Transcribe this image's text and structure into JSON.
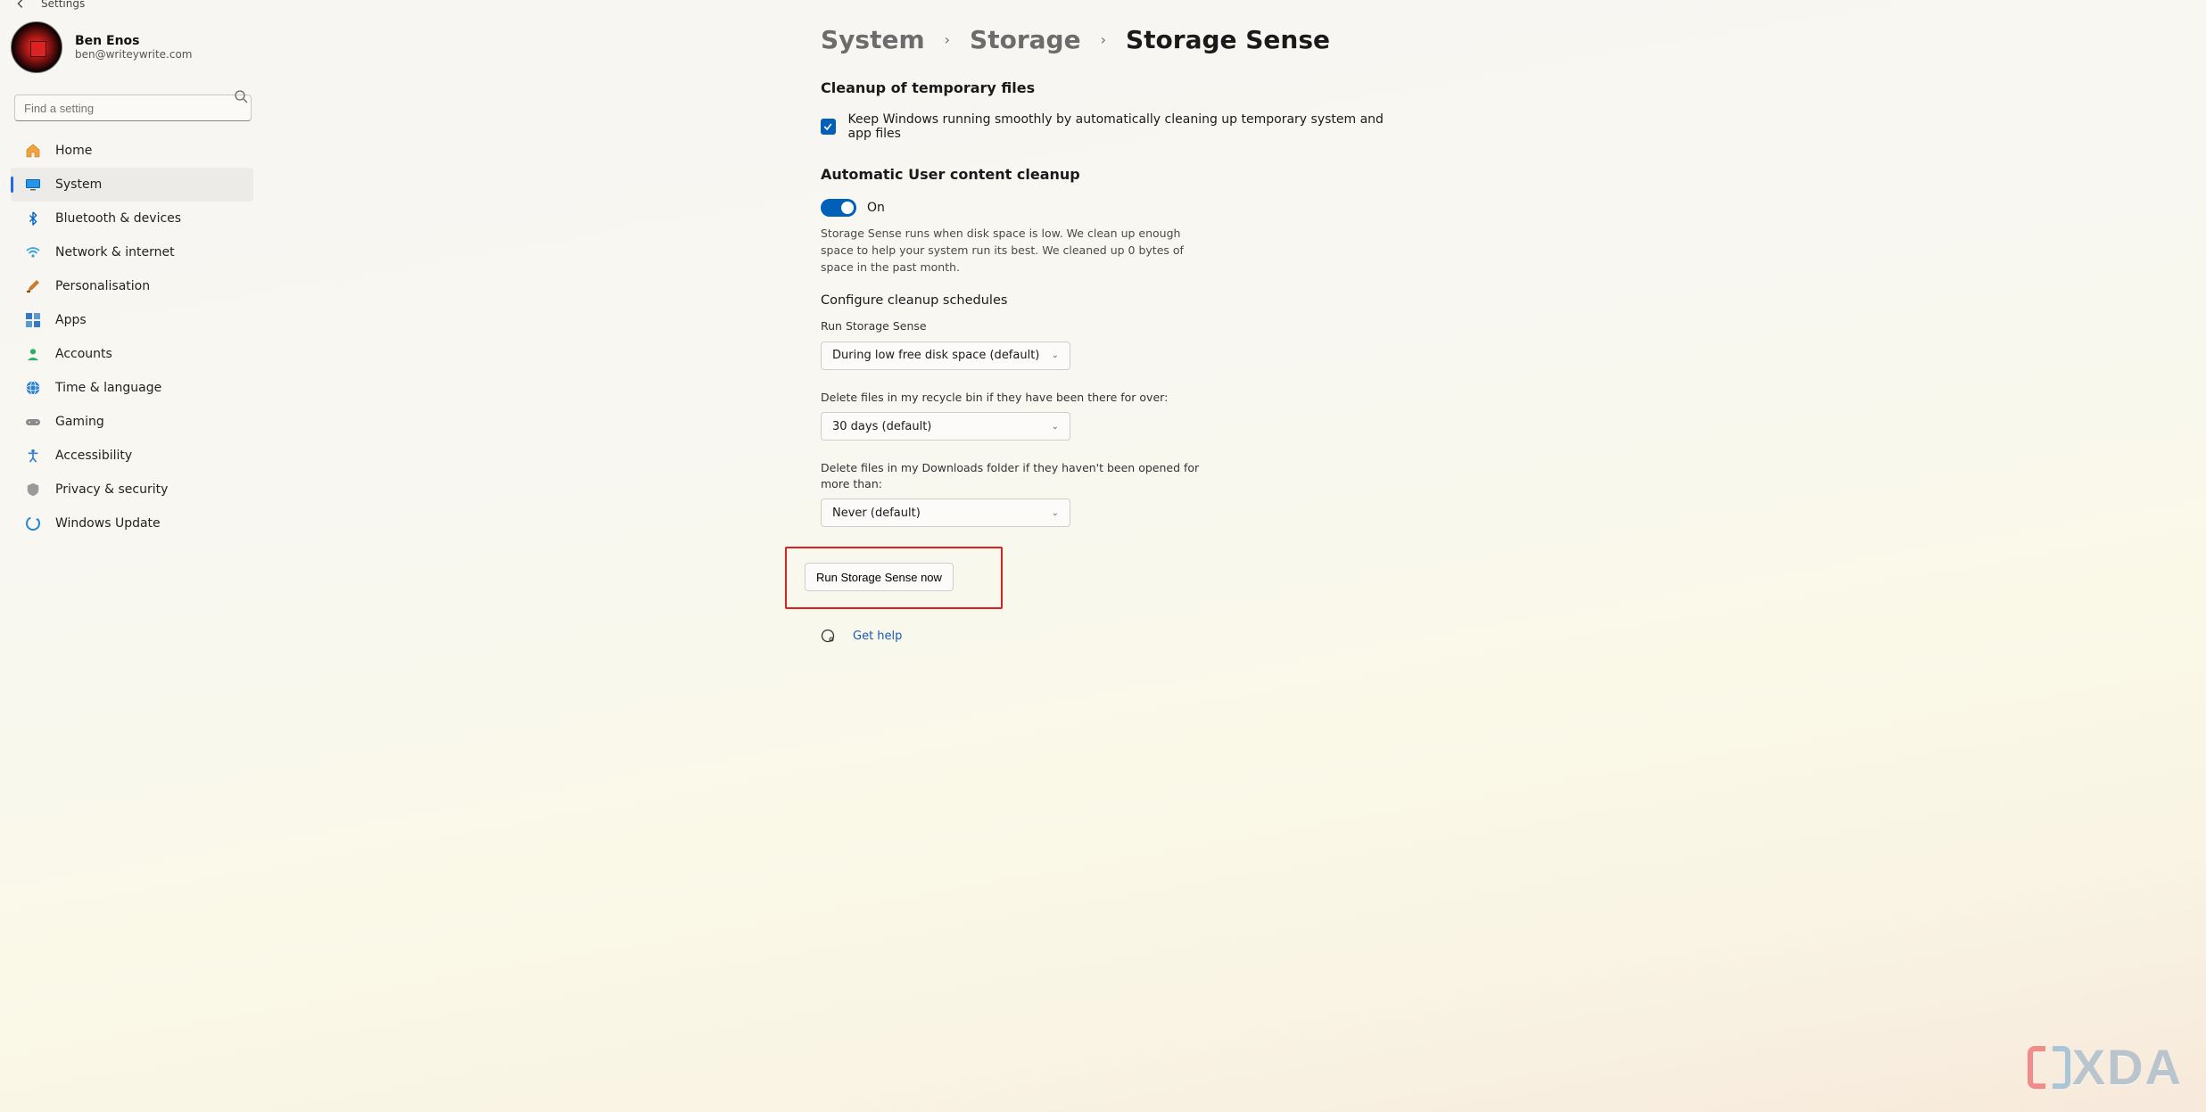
{
  "titlebar": {
    "label": "Settings"
  },
  "user": {
    "name": "Ben Enos",
    "email": "ben@writeywrite.com"
  },
  "search": {
    "placeholder": "Find a setting"
  },
  "nav": {
    "items": [
      {
        "label": "Home"
      },
      {
        "label": "System"
      },
      {
        "label": "Bluetooth & devices"
      },
      {
        "label": "Network & internet"
      },
      {
        "label": "Personalisation"
      },
      {
        "label": "Apps"
      },
      {
        "label": "Accounts"
      },
      {
        "label": "Time & language"
      },
      {
        "label": "Gaming"
      },
      {
        "label": "Accessibility"
      },
      {
        "label": "Privacy & security"
      },
      {
        "label": "Windows Update"
      }
    ],
    "selected_index": 1
  },
  "breadcrumb": {
    "part1": "System",
    "part2": "Storage",
    "part3": "Storage Sense",
    "chevron": "›"
  },
  "sections": {
    "cleanup_temp": {
      "heading": "Cleanup of temporary files",
      "checkbox_label": "Keep Windows running smoothly by automatically cleaning up temporary system and app files",
      "checkbox_checked": true
    },
    "auto_user": {
      "heading": "Automatic User content cleanup",
      "toggle_label": "On",
      "toggle_on": true,
      "description": "Storage Sense runs when disk space is low. We clean up enough space to help your system run its best. We cleaned up 0 bytes of space in the past month."
    },
    "schedules": {
      "heading": "Configure cleanup schedules",
      "run_label": "Run Storage Sense",
      "run_value": "During low free disk space (default)",
      "recycle_label": "Delete files in my recycle bin if they have been there for over:",
      "recycle_value": "30 days (default)",
      "downloads_label": "Delete files in my Downloads folder if they haven't been opened for more than:",
      "downloads_value": "Never (default)",
      "run_now_button": "Run Storage Sense now"
    }
  },
  "help": {
    "label": "Get help"
  },
  "watermark": {
    "text": "XDA"
  },
  "icons": {
    "home": "#f1a33c",
    "system": "#0067c0",
    "bluetooth": "#0067c0",
    "network": "#2fa3e0",
    "personalisation": "#c97b2e",
    "apps": "#3478c6",
    "accounts": "#2cae66",
    "time": "#2e7fcf",
    "gaming": "#7a7a7a",
    "accessibility": "#2e7fcf",
    "privacy": "#8a8a8a",
    "update": "#1e88d6"
  }
}
